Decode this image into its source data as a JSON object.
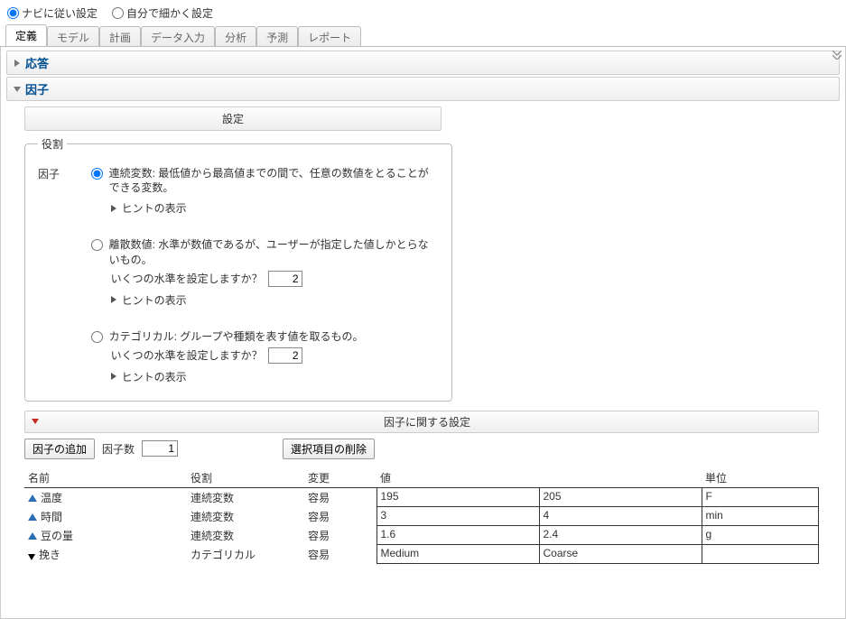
{
  "top": {
    "option_navi": "ナビに従い設定",
    "option_manual": "自分で細かく設定"
  },
  "tabs": [
    "定義",
    "モデル",
    "計画",
    "データ入力",
    "分析",
    "予測",
    "レポート"
  ],
  "active_tab_index": 0,
  "sections": {
    "response": "応答",
    "factor": "因子"
  },
  "settings_header": "設定",
  "roles": {
    "legend": "役割",
    "label": "因子",
    "hint_label": "ヒントの表示",
    "continuous": "連続変数: 最低値から最高値までの間で、任意の数値をとることができる変数。",
    "discrete": "離散数値: 水準が数値であるが、ユーザーが指定した値しかとらないもの。",
    "categorical": "カテゴリカル: グループや種類を表す値を取るもの。",
    "levels_prompt": "いくつの水準を設定しますか？",
    "discrete_levels": "2",
    "categorical_levels": "2"
  },
  "factors_panel": {
    "title": "因子に関する設定",
    "add_button": "因子の追加",
    "count_label": "因子数",
    "count_value": "1",
    "delete_button": "選択項目の削除",
    "headers": {
      "name": "名前",
      "role": "役割",
      "change": "変更",
      "value": "値",
      "unit": "単位"
    },
    "rows": [
      {
        "kind": "cont",
        "name": "温度",
        "role": "連続変数",
        "change": "容易",
        "v1": "195",
        "v2": "205",
        "unit": "F"
      },
      {
        "kind": "cont",
        "name": "時間",
        "role": "連続変数",
        "change": "容易",
        "v1": "3",
        "v2": "4",
        "unit": "min"
      },
      {
        "kind": "cont",
        "name": "豆の量",
        "role": "連続変数",
        "change": "容易",
        "v1": "1.6",
        "v2": "2.4",
        "unit": "g"
      },
      {
        "kind": "cat",
        "name": "挽き",
        "role": "カテゴリカル",
        "change": "容易",
        "v1": "Medium",
        "v2": "Coarse",
        "unit": ""
      }
    ]
  }
}
